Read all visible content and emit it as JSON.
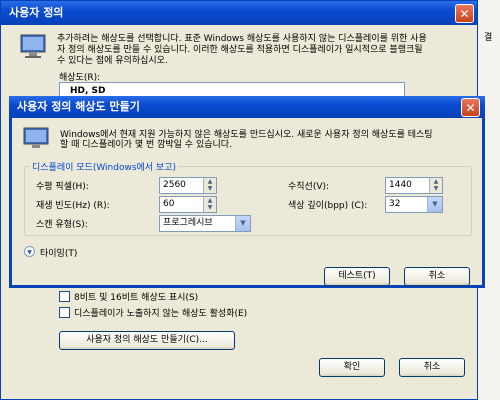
{
  "parent": {
    "title": "사용자 정의",
    "desc_line1": "추가하려는 해상도를 선택합니다. 표준 Windows 해상도를 사용하지 않는 디스플레이를 위한 사용",
    "desc_line2": "자 정의 해상도를 만들 수 있습니다. 이러한 해상도를 적용하면 디스플레이가 일시적으로 블랭크될",
    "desc_line3": "수 있다는 점에 유의하십시오.",
    "resolution_label": "해상도(R):",
    "resolution_first_item": "HD, SD",
    "checkbox1_label": "8비트 및 16비트 해상도 표시(S)",
    "checkbox2_label": "디스플레이가 노출하지 않는 해상도 활성화(E)",
    "create_button": "사용자 정의 해상도 만들기(C)...",
    "ok_button": "확인",
    "cancel_button": "취소",
    "right_edge_text": "결"
  },
  "dialog": {
    "title": "사용자 정의 해상도 만들기",
    "close_glyph": "✕",
    "desc_line1": "Windows에서 현재 지원 가능하지 않은 해상도를 만드십시오. 새로운 사용자 정의 해상도를 테스팅",
    "desc_line2": "할 때 디스플레이가 몇 번 깜박일 수 있습니다.",
    "group_label": "디스플레이 모드(Windows에서 보고)",
    "horizontal_label": "수평 픽셀(H):",
    "horizontal_value": "2560",
    "vertical_label": "수직선(V):",
    "vertical_value": "1440",
    "refresh_label": "재생 빈도(Hz) (R):",
    "refresh_value": "60",
    "color_label": "색상 깊이(bpp) (C):",
    "color_value": "32",
    "scan_label": "스캔 유형(S):",
    "scan_value": "프로그레시브",
    "timing_label": "타이밍(T)",
    "test_button": "테스트(T)",
    "cancel_button": "취소"
  },
  "colors": {
    "accent": "#0a4ad0",
    "group_text": "#0046d5"
  }
}
